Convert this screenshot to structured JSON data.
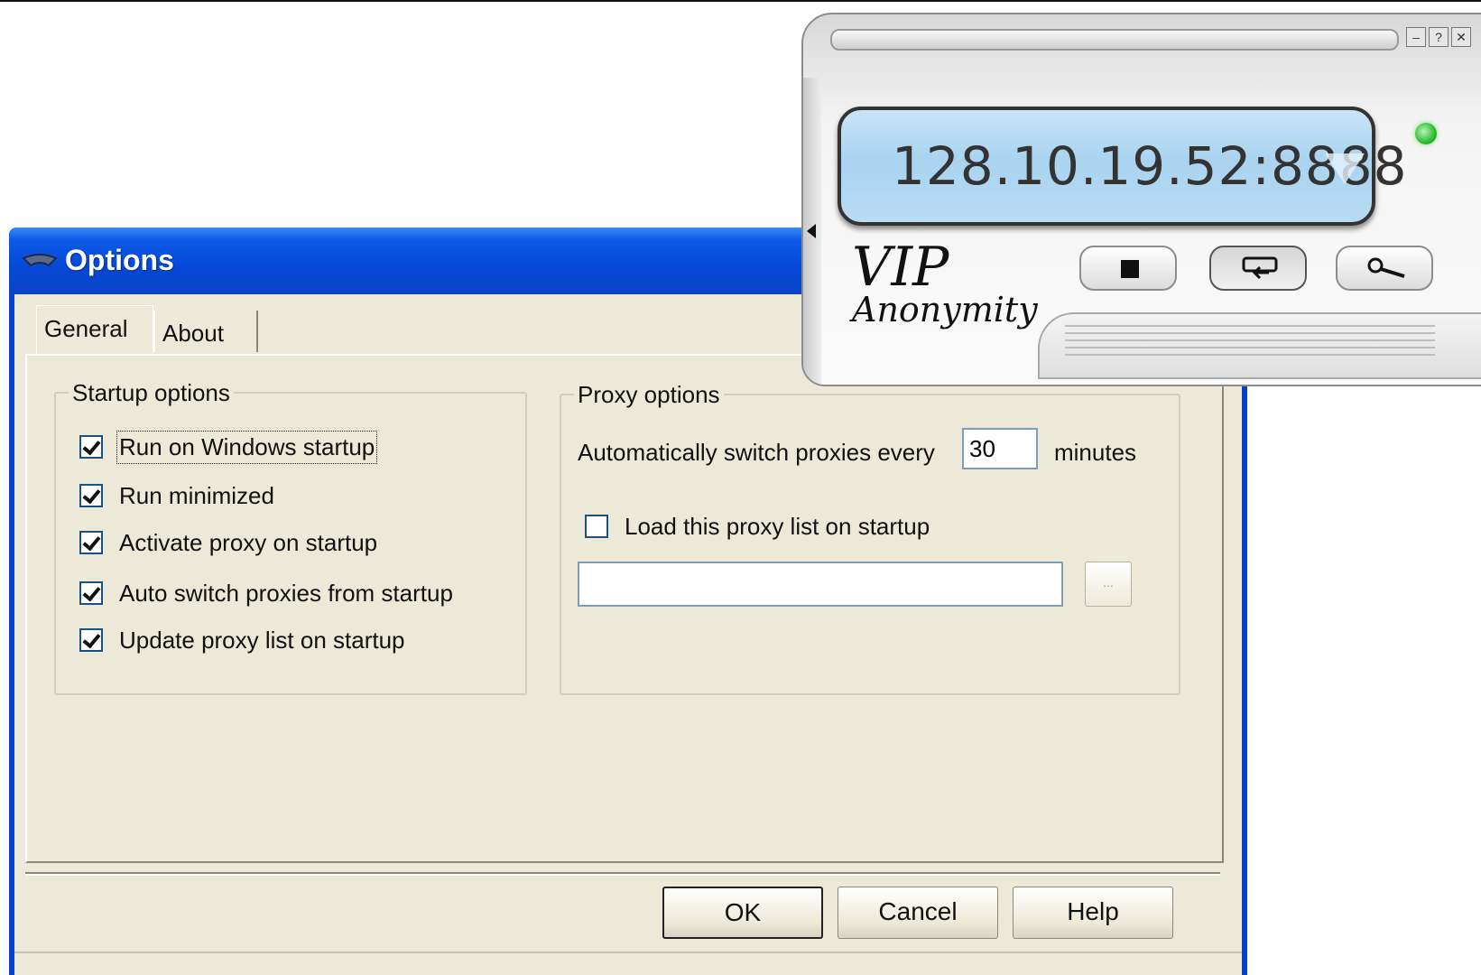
{
  "dialog": {
    "title": "Options",
    "tabs": [
      {
        "label": "General"
      },
      {
        "label": "About"
      }
    ],
    "startup": {
      "legend": "Startup options",
      "items": [
        {
          "label": "Run on Windows startup",
          "checked": true
        },
        {
          "label": "Run minimized",
          "checked": true
        },
        {
          "label": "Activate proxy on startup",
          "checked": true
        },
        {
          "label": "Auto switch proxies from startup",
          "checked": true
        },
        {
          "label": "Update proxy list on startup",
          "checked": true
        }
      ]
    },
    "proxy": {
      "legend": "Proxy options",
      "auto_switch_label": "Automatically switch proxies every",
      "minutes_value": "30",
      "minutes_label": "minutes",
      "load_list_label": "Load this proxy list on startup",
      "load_list_checked": false,
      "path_value": "",
      "browse_label": "..."
    },
    "buttons": {
      "ok": "OK",
      "cancel": "Cancel",
      "help": "Help"
    }
  },
  "widget": {
    "address": "128.10.19.52:8888",
    "logo_line1": "VIP",
    "logo_line2": "Anonymity",
    "status_color": "#2dbb2d",
    "controls": [
      "minimize-icon",
      "help-icon",
      "close-icon"
    ],
    "buttons": [
      "stop-icon",
      "switch-proxy-icon",
      "search-icon"
    ]
  }
}
